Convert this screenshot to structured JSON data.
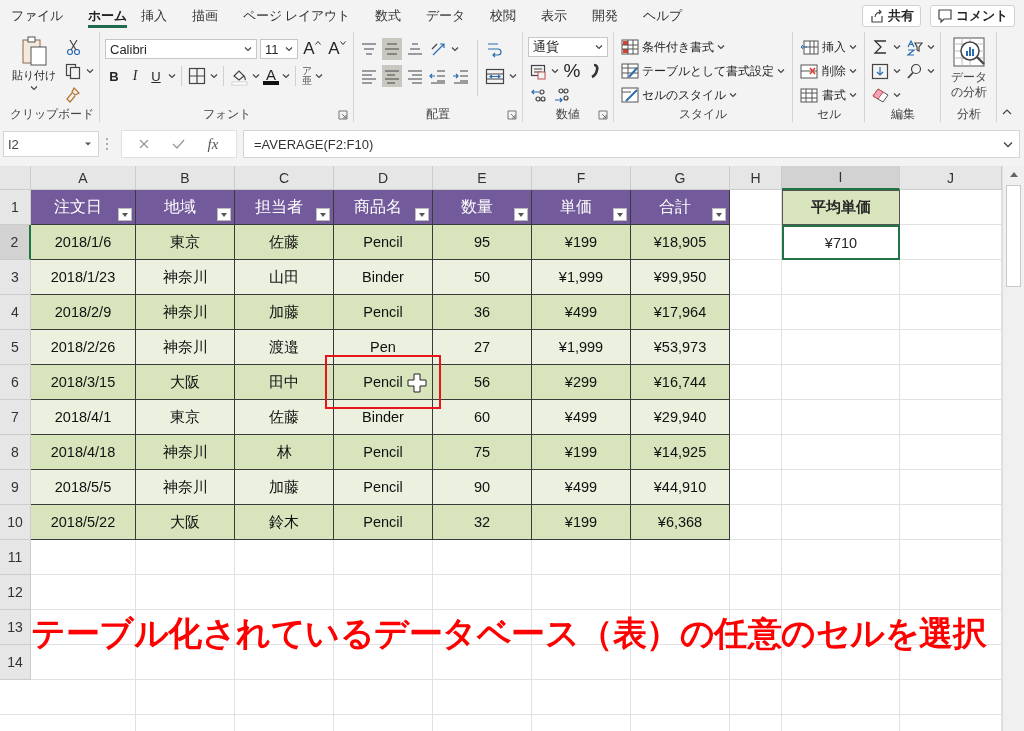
{
  "menu_tabs": [
    {
      "label": "ファイル",
      "selected": false
    },
    {
      "label": "ホーム",
      "selected": true
    },
    {
      "label": "挿入",
      "selected": false
    },
    {
      "label": "描画",
      "selected": false
    },
    {
      "label": "ページ レイアウト",
      "selected": false
    },
    {
      "label": "数式",
      "selected": false
    },
    {
      "label": "データ",
      "selected": false
    },
    {
      "label": "校閲",
      "selected": false
    },
    {
      "label": "表示",
      "selected": false
    },
    {
      "label": "開発",
      "selected": false
    },
    {
      "label": "ヘルプ",
      "selected": false
    }
  ],
  "share_button": "共有",
  "comment_button": "コメント",
  "ribbon": {
    "clipboard": {
      "label": "クリップボード",
      "paste": "貼り付け"
    },
    "font": {
      "label": "フォント",
      "name": "Calibri",
      "size": "11",
      "grow": "A",
      "shrink": "A",
      "bold": "B",
      "italic": "I",
      "underline": "U",
      "font_color": "A",
      "phonetic": "ア亜"
    },
    "alignment": {
      "label": "配置",
      "vertical": [
        {
          "selected": false
        },
        {
          "selected": true
        },
        {
          "selected": false
        }
      ],
      "horizontal": [
        {
          "selected": false
        },
        {
          "selected": true
        },
        {
          "selected": false
        }
      ]
    },
    "number": {
      "label": "数値",
      "format": "通貨",
      "percent": "%"
    },
    "styles": {
      "label": "スタイル",
      "buttons": [
        "条件付き書式",
        "テーブルとして書式設定",
        "セルのスタイル"
      ]
    },
    "cells": {
      "label": "セル",
      "buttons": [
        "挿入",
        "削除",
        "書式"
      ]
    },
    "editing": {
      "label": "編集"
    },
    "analysis": {
      "label": "分析",
      "button": "データの分析"
    }
  },
  "formula_bar": {
    "name_box": "I2",
    "function_button": "fx",
    "formula": "=AVERAGE(F2:F10)"
  },
  "sheet": {
    "columns": [
      {
        "label": "A",
        "selected": false
      },
      {
        "label": "B",
        "selected": false
      },
      {
        "label": "C",
        "selected": false
      },
      {
        "label": "D",
        "selected": false
      },
      {
        "label": "E",
        "selected": false
      },
      {
        "label": "F",
        "selected": false
      },
      {
        "label": "G",
        "selected": false
      },
      {
        "label": "H",
        "selected": false
      },
      {
        "label": "I",
        "selected": true
      },
      {
        "label": "J",
        "selected": false
      }
    ],
    "rows": [
      {
        "label": "1",
        "selected": false
      },
      {
        "label": "2",
        "selected": true
      },
      {
        "label": "3",
        "selected": false
      },
      {
        "label": "4",
        "selected": false
      },
      {
        "label": "5",
        "selected": false
      },
      {
        "label": "6",
        "selected": false
      },
      {
        "label": "7",
        "selected": false
      },
      {
        "label": "8",
        "selected": false
      },
      {
        "label": "9",
        "selected": false
      },
      {
        "label": "10",
        "selected": false
      },
      {
        "label": "11",
        "selected": false
      },
      {
        "label": "12",
        "selected": false
      },
      {
        "label": "13",
        "selected": false
      },
      {
        "label": "14",
        "selected": false
      }
    ],
    "table": {
      "header": [
        "注文日",
        "地域",
        "担当者",
        "商品名",
        "数量",
        "単価",
        "合計"
      ],
      "rows": [
        [
          {
            "text": "2018/1/6",
            "highlighted": false
          },
          {
            "text": "東京",
            "highlighted": false
          },
          {
            "text": "佐藤",
            "highlighted": false
          },
          {
            "text": "Pencil",
            "highlighted": false
          },
          {
            "text": "95",
            "highlighted": false
          },
          {
            "text": "¥199",
            "highlighted": false
          },
          {
            "text": "¥18,905",
            "highlighted": false
          }
        ],
        [
          {
            "text": "2018/1/23",
            "highlighted": false
          },
          {
            "text": "神奈川",
            "highlighted": false
          },
          {
            "text": "山田",
            "highlighted": false
          },
          {
            "text": "Binder",
            "highlighted": false
          },
          {
            "text": "50",
            "highlighted": false
          },
          {
            "text": "¥1,999",
            "highlighted": false
          },
          {
            "text": "¥99,950",
            "highlighted": false
          }
        ],
        [
          {
            "text": "2018/2/9",
            "highlighted": false
          },
          {
            "text": "神奈川",
            "highlighted": false
          },
          {
            "text": "加藤",
            "highlighted": false
          },
          {
            "text": "Pencil",
            "highlighted": false
          },
          {
            "text": "36",
            "highlighted": false
          },
          {
            "text": "¥499",
            "highlighted": false
          },
          {
            "text": "¥17,964",
            "highlighted": false
          }
        ],
        [
          {
            "text": "2018/2/26",
            "highlighted": false
          },
          {
            "text": "神奈川",
            "highlighted": false
          },
          {
            "text": "渡邉",
            "highlighted": false
          },
          {
            "text": "Pen",
            "highlighted": false
          },
          {
            "text": "27",
            "highlighted": false
          },
          {
            "text": "¥1,999",
            "highlighted": false
          },
          {
            "text": "¥53,973",
            "highlighted": false
          }
        ],
        [
          {
            "text": "2018/3/15",
            "highlighted": false
          },
          {
            "text": "大阪",
            "highlighted": false
          },
          {
            "text": "田中",
            "highlighted": false
          },
          {
            "text": "Pencil",
            "highlighted": true
          },
          {
            "text": "56",
            "highlighted": false
          },
          {
            "text": "¥299",
            "highlighted": false
          },
          {
            "text": "¥16,744",
            "highlighted": false
          }
        ],
        [
          {
            "text": "2018/4/1",
            "highlighted": false
          },
          {
            "text": "東京",
            "highlighted": false
          },
          {
            "text": "佐藤",
            "highlighted": false
          },
          {
            "text": "Binder",
            "highlighted": false
          },
          {
            "text": "60",
            "highlighted": false
          },
          {
            "text": "¥499",
            "highlighted": false
          },
          {
            "text": "¥29,940",
            "highlighted": false
          }
        ],
        [
          {
            "text": "2018/4/18",
            "highlighted": false
          },
          {
            "text": "神奈川",
            "highlighted": false
          },
          {
            "text": "林",
            "highlighted": false
          },
          {
            "text": "Pencil",
            "highlighted": false
          },
          {
            "text": "75",
            "highlighted": false
          },
          {
            "text": "¥199",
            "highlighted": false
          },
          {
            "text": "¥14,925",
            "highlighted": false
          }
        ],
        [
          {
            "text": "2018/5/5",
            "highlighted": false
          },
          {
            "text": "神奈川",
            "highlighted": false
          },
          {
            "text": "加藤",
            "highlighted": false
          },
          {
            "text": "Pencil",
            "highlighted": false
          },
          {
            "text": "90",
            "highlighted": false
          },
          {
            "text": "¥499",
            "highlighted": false
          },
          {
            "text": "¥44,910",
            "highlighted": false
          }
        ],
        [
          {
            "text": "2018/5/22",
            "highlighted": false
          },
          {
            "text": "大阪",
            "highlighted": false
          },
          {
            "text": "鈴木",
            "highlighted": false
          },
          {
            "text": "Pencil",
            "highlighted": false
          },
          {
            "text": "32",
            "highlighted": false
          },
          {
            "text": "¥199",
            "highlighted": false
          },
          {
            "text": "¥6,368",
            "highlighted": false
          }
        ]
      ]
    },
    "summary": {
      "header": "平均単価",
      "value": "¥710",
      "selected": true
    }
  },
  "annotation": "テーブル化されているデータベース（表）の任意のセルを選択"
}
